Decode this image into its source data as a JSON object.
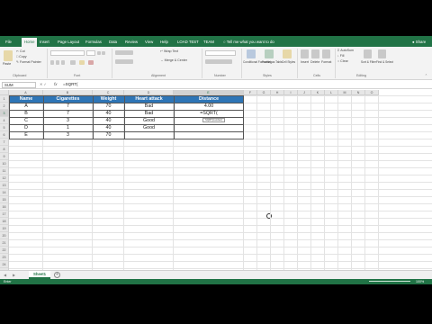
{
  "ribbon_tabs": [
    "File",
    "Home",
    "Insert",
    "Page Layout",
    "Formulas",
    "Data",
    "Review",
    "View",
    "Help",
    "LOAD TEST",
    "TEAM"
  ],
  "active_tab": "Home",
  "tell_me": "Tell me what you want to do",
  "share": "Share",
  "ribbon": {
    "clipboard": {
      "paste": "Paste",
      "cut": "Cut",
      "copy": "Copy",
      "format_painter": "Format Painter",
      "label": "Clipboard"
    },
    "font": {
      "label": "Font"
    },
    "alignment": {
      "wrap_text": "Wrap Text",
      "merge": "Merge & Center",
      "label": "Alignment"
    },
    "number": {
      "label": "Number"
    },
    "styles": {
      "conditional": "Conditional Formatting",
      "format_table": "Format as Table",
      "cell_styles": "Cell Styles",
      "label": "Styles"
    },
    "cells": {
      "insert": "Insert",
      "delete": "Delete",
      "format": "Format",
      "label": "Cells"
    },
    "editing": {
      "autosum": "AutoSum",
      "fill": "Fill",
      "clear": "Clear",
      "sort": "Sort & Filter",
      "find": "Find & Select",
      "label": "Editing"
    }
  },
  "formula_bar": {
    "name_box": "SUM",
    "fx": "fx",
    "content": "=SQRT("
  },
  "columns": [
    "A",
    "B",
    "C",
    "D",
    "E",
    "F",
    "G",
    "H",
    "I",
    "J",
    "K",
    "L",
    "M",
    "N",
    "O"
  ],
  "rows": [
    "1",
    "2",
    "3",
    "4",
    "5",
    "6",
    "7",
    "8",
    "9",
    "10",
    "11",
    "12",
    "13",
    "14",
    "15",
    "16",
    "17",
    "18",
    "19",
    "20",
    "21",
    "22",
    "23",
    "24",
    "25",
    "26",
    "27",
    "28",
    "29"
  ],
  "table": {
    "headers": [
      "Name",
      "Cigarettes",
      "Weight",
      "Heart attack",
      "Distance"
    ],
    "rows": [
      [
        "A",
        "7",
        "70",
        "Bad",
        "4.00"
      ],
      [
        "B",
        "7",
        "40",
        "Bad",
        "=SQRT("
      ],
      [
        "C",
        "3",
        "40",
        "Good",
        ""
      ],
      [
        "D",
        "1",
        "40",
        "Good",
        ""
      ],
      [
        "E",
        "3",
        "70",
        "",
        ""
      ]
    ]
  },
  "tooltip": "SQRT(number)",
  "sheet_tab": "Sheet1",
  "status": "Enter",
  "zoom": "100%",
  "colors": {
    "excel_green": "#217346",
    "table_header": "#2e75b6"
  }
}
